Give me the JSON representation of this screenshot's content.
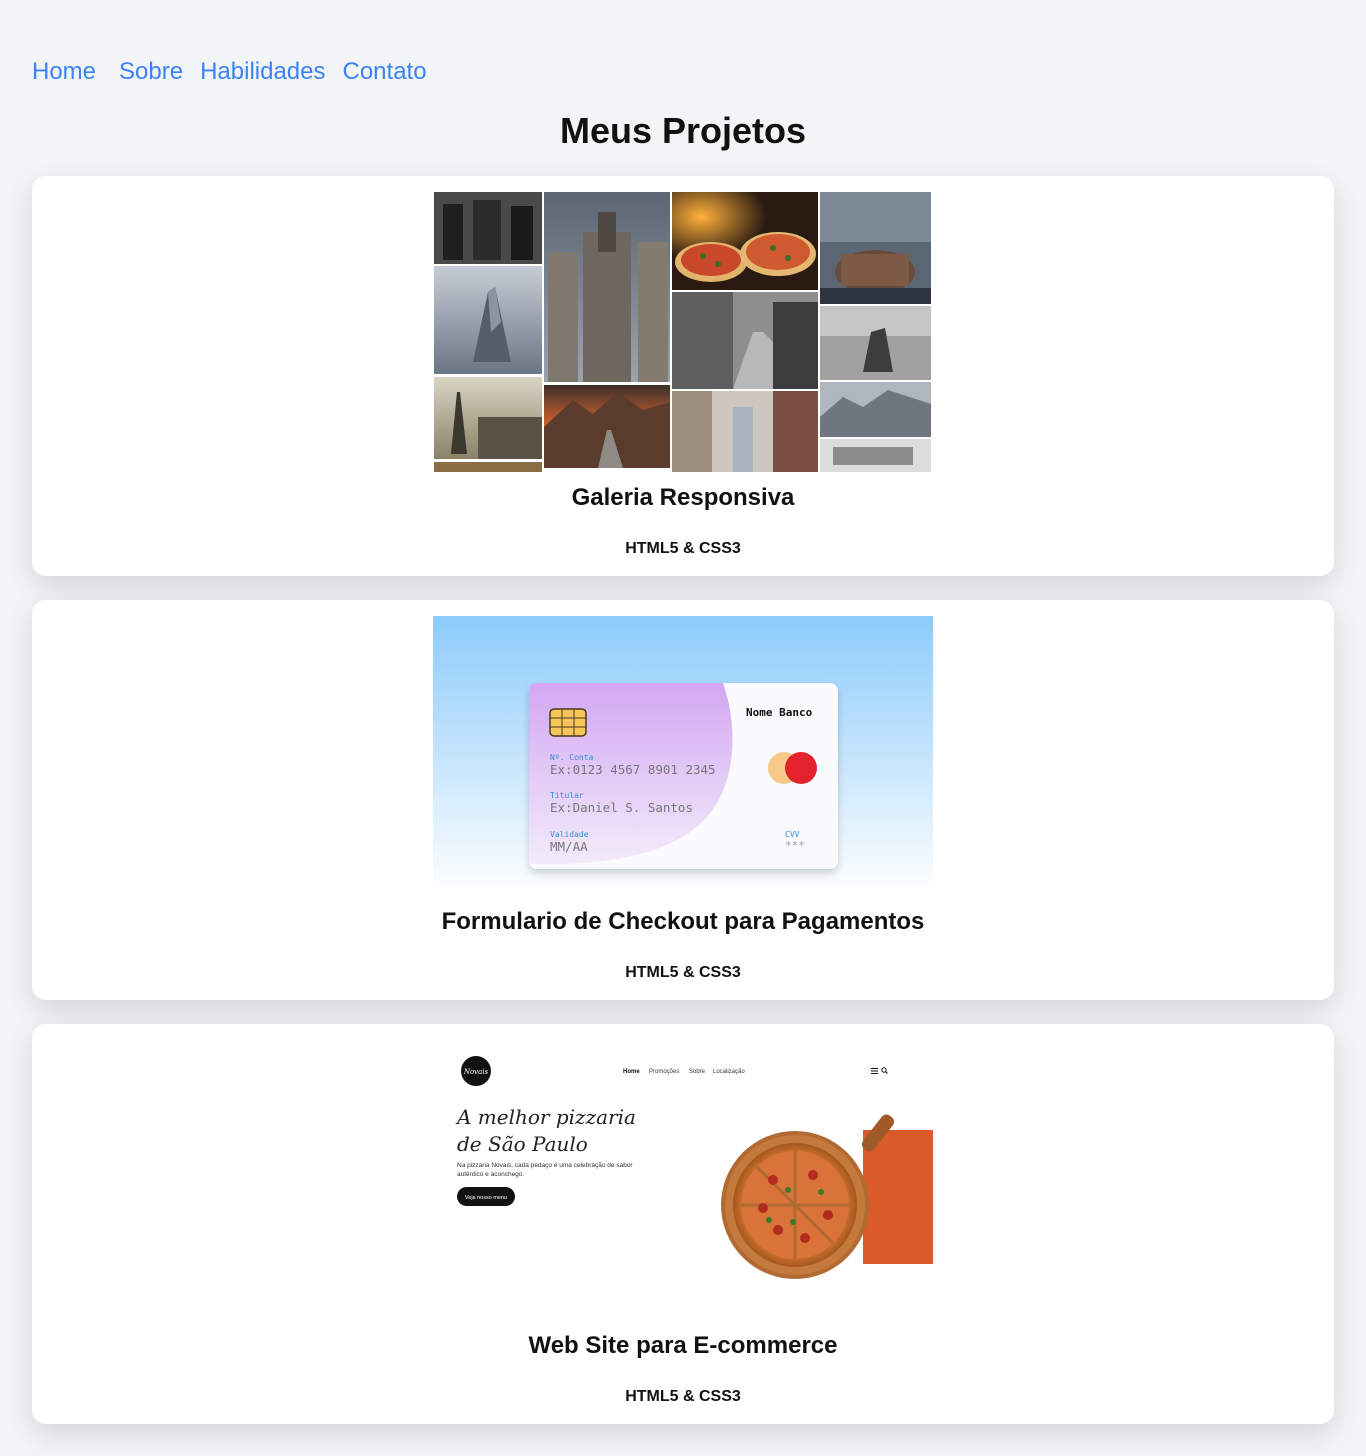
{
  "nav": {
    "items": [
      "Home",
      "Sobre",
      "Habilidades",
      "Contato"
    ]
  },
  "page": {
    "title": "Meus Projetos"
  },
  "projects": [
    {
      "title": "Galeria Responsiva",
      "tech": "HTML5 & CSS3"
    },
    {
      "title": "Formulario de Checkout para Pagamentos",
      "tech": "HTML5 & CSS3",
      "preview": {
        "bank_name": "Nome Banco",
        "account_label": "Nº. Conta",
        "account_placeholder": "Ex:0123 4567 8901 2345",
        "holder_label": "Titular",
        "holder_placeholder": "Ex:Daniel S. Santos",
        "expiry_label": "Validade",
        "expiry_placeholder": "MM/AA",
        "cvv_label": "CVV",
        "cvv_placeholder": "***"
      }
    },
    {
      "title": "Web Site para E-commerce",
      "tech": "HTML5 & CSS3",
      "preview": {
        "logo": "Novais",
        "menu": [
          "Home",
          "Promoções",
          "Sobre",
          "Localização"
        ],
        "headline_1": "A melhor pizzaria",
        "headline_2": "de São Paulo",
        "subtext_1": "Na pizzaria Novais, cada pedaço é uma celebração de sabor",
        "subtext_2": "autêntico e aconchego.",
        "cta": "Veja nosso menu"
      }
    }
  ],
  "colors": {
    "background": "#f3f4f6",
    "link": "#3b82f6",
    "card": "#ffffff",
    "accent_orange": "#d95a2b"
  }
}
